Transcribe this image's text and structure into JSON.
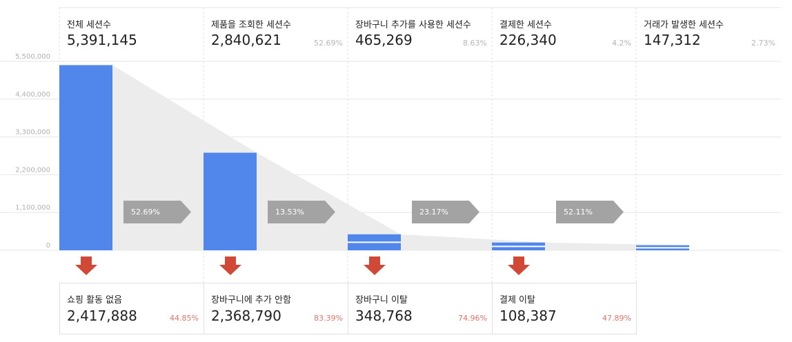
{
  "chart_data": {
    "type": "bar",
    "ylim": [
      0,
      5500000
    ],
    "yticks": [
      "5,500,000",
      "4,400,000",
      "3,300,000",
      "2,200,000",
      "1,100,000",
      "0"
    ],
    "ytick_values": [
      5500000,
      4400000,
      3300000,
      2200000,
      1100000,
      0
    ],
    "categories": [
      "전체 세션수",
      "제품을 조회한 세션수",
      "장바구니 추가를 사용한 세션수",
      "결제한 세션수",
      "거래가 발생한 세션수"
    ],
    "values": [
      5391145,
      2840621,
      465269,
      226340,
      147312
    ],
    "stages": [
      {
        "title": "전체 세션수",
        "value": 5391145,
        "value_label": "5,391,145",
        "pct": ""
      },
      {
        "title": "제품을 조회한 세션수",
        "value": 2840621,
        "value_label": "2,840,621",
        "pct": "52.69%"
      },
      {
        "title": "장바구니 추가를 사용한 세션수",
        "value": 465269,
        "value_label": "465,269",
        "pct": "8.63%"
      },
      {
        "title": "결제한 세션수",
        "value": 226340,
        "value_label": "226,340",
        "pct": "4.2%"
      },
      {
        "title": "거래가 발생한 세션수",
        "value": 147312,
        "value_label": "147,312",
        "pct": "2.73%"
      }
    ],
    "conversions": [
      "52.69%",
      "13.53%",
      "23.17%",
      "52.11%"
    ],
    "dropoffs": [
      {
        "title": "쇼핑 활동 없음",
        "value": 2417888,
        "value_label": "2,417,888",
        "pct": "44.85%"
      },
      {
        "title": "장바구니에 추가 안함",
        "value": 2368790,
        "value_label": "2,368,790",
        "pct": "83.39%"
      },
      {
        "title": "장바구니 이탈",
        "value": 348768,
        "value_label": "348,768",
        "pct": "74.96%"
      },
      {
        "title": "결제 이탈",
        "value": 108387,
        "value_label": "108,387",
        "pct": "47.89%"
      }
    ],
    "colors": {
      "bar": "#5187ea",
      "connector": "#ececec",
      "arrow": "#a3a3a3",
      "drop_arrow": "#d14836",
      "drop_text": "#e57368",
      "grid": "#e6e6e6"
    }
  }
}
